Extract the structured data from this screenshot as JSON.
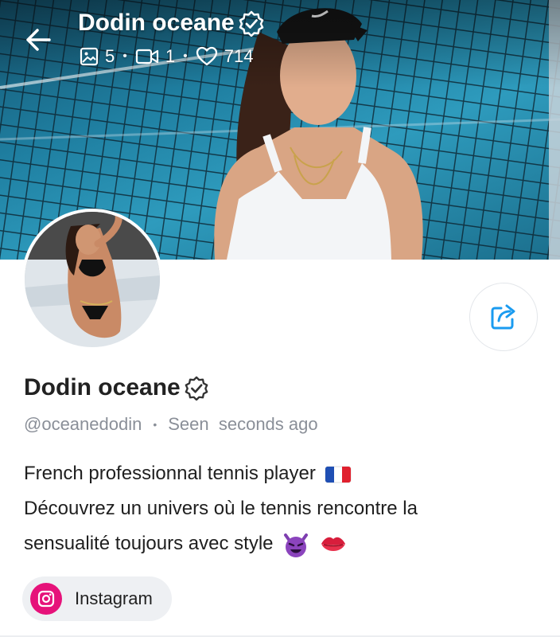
{
  "header": {
    "title": "Dodin oceane",
    "stats": {
      "photos": "5",
      "videos": "1",
      "likes": "714"
    }
  },
  "profile": {
    "name": "Dodin oceane",
    "username": "@oceanedodin",
    "status": "Seen  seconds ago",
    "verified": true,
    "bio_line_1": "French professionnal tennis player",
    "bio_line_2": "Découvrez un univers où le tennis rencontre la",
    "bio_line_3": "sensualité toujours avec style",
    "bio_emojis": [
      "flag-france-icon",
      "smiling-devil-icon",
      "kiss-lips-icon"
    ]
  },
  "social_links": [
    {
      "label": "Instagram",
      "icon": "instagram-icon"
    }
  ],
  "colors": {
    "accent": "#1a9bf0",
    "instagram": "#e6127a",
    "muted_text": "#8a8f98",
    "chip_bg": "#eef0f3"
  }
}
